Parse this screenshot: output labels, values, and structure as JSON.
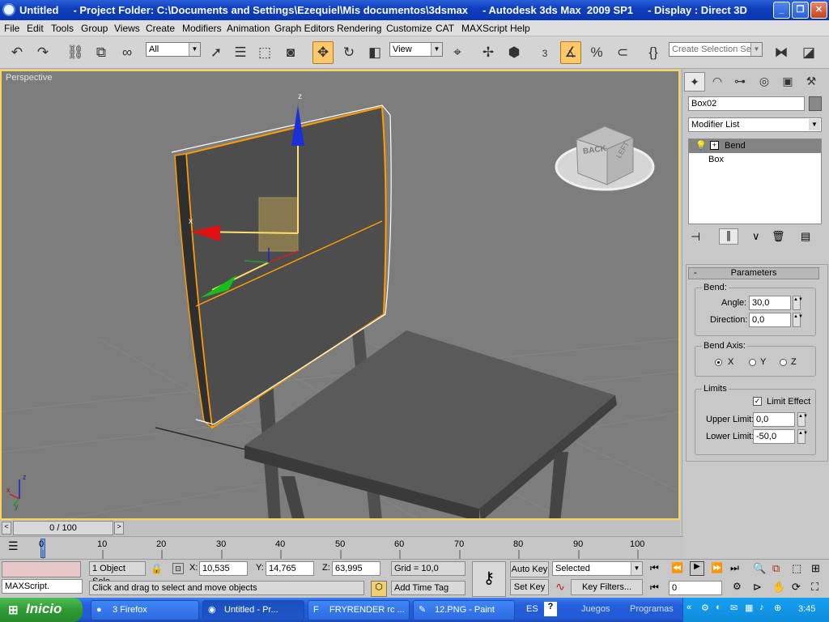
{
  "window": {
    "title": "Untitled     - Project Folder: C:\\Documents and Settings\\Ezequiel\\Mis documentos\\3dsmax     - Autodesk 3ds Max  2009 SP1     - Display : Direct 3D",
    "min": "_",
    "max": "❐",
    "close": "✕"
  },
  "menu": [
    "File",
    "Edit",
    "Tools",
    "Group",
    "Views",
    "Create",
    "Modifiers",
    "Animation",
    "Graph Editors",
    "Rendering",
    "Customize",
    "CAT",
    "MAXScript",
    "Help"
  ],
  "toolbar": {
    "selection_filter": "All",
    "ref_coord": "View",
    "named_selection_placeholder": "Create Selection Set",
    "snap_3": "3",
    "snap_pct": "%"
  },
  "viewport": {
    "label": "Perspective",
    "viewcube_front": "BACK",
    "viewcube_side": "LEFT",
    "gizmo_z": "z",
    "gizmo_x": "x",
    "axis_z": "z",
    "axis_x": "x",
    "axis_y": "y"
  },
  "panel": {
    "object_name": "Box02",
    "modifier_list": "Modifier List",
    "stack": [
      "Bend",
      "Box"
    ],
    "rollout_title": "Parameters",
    "bend_group": "Bend:",
    "angle_label": "Angle:",
    "angle_value": "30,0",
    "direction_label": "Direction:",
    "direction_value": "0,0",
    "axis_group": "Bend Axis:",
    "axis_x": "X",
    "axis_y": "Y",
    "axis_z": "Z",
    "limits_group": "Limits",
    "limit_effect": "Limit Effect",
    "upper_label": "Upper Limit:",
    "upper_value": "0,0",
    "lower_label": "Lower Limit:",
    "lower_value": "-50,0"
  },
  "timeline": {
    "slider": "0 / 100",
    "ticks": [
      "0",
      "10",
      "20",
      "30",
      "40",
      "50",
      "60",
      "70",
      "80",
      "90",
      "100"
    ]
  },
  "status": {
    "selection_info": "1 Object Sele",
    "x_label": "X:",
    "x_value": "10,535",
    "y_label": "Y:",
    "y_value": "14,765",
    "z_label": "Z:",
    "z_value": "63,995",
    "grid": "Grid = 10,0",
    "prompt": "Click and drag to select and move objects",
    "time_tag": "Add Time Tag",
    "maxscript": "MAXScript.",
    "auto_key": "Auto Key",
    "set_key": "Set Key",
    "key_mode": "Selected",
    "key_filters": "Key Filters...",
    "frame": "0"
  },
  "taskbar": {
    "start": "Inicio",
    "tasks": [
      "3 Firefox",
      "Untitled    - Pr...",
      "FRYRENDER rc ...",
      "12.PNG - Paint"
    ],
    "lang": "ES",
    "toolbars": [
      "Juegos",
      "Programas"
    ],
    "clock": "3:45"
  }
}
